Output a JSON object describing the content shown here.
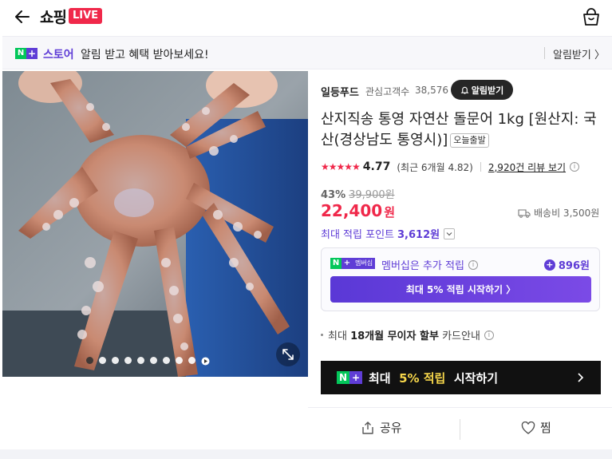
{
  "header": {
    "logo_text": "쇼핑",
    "live_badge": "LIVE",
    "back_icon": "arrow-left-icon",
    "cart_icon": "shopping-bag-icon"
  },
  "store_bar": {
    "n_badge": "N",
    "plus_badge": "+",
    "store_label": "스토어",
    "message": "알림 받고 혜택 받아보세요!",
    "alarm_link": "알림받기 〉"
  },
  "gallery": {
    "dot_count": 10,
    "active_index": 0,
    "expand_icon": "expand-arrows-icon",
    "play_icon": "play-icon"
  },
  "product": {
    "seller": "일등푸드",
    "fans_label": "관심고객수",
    "fans_count": "38,576",
    "alarm_button": "알림받기",
    "title": "산지직송 통영 자연산 돌문어 1kg [원산지: 국산(경상남도 통영시)]",
    "today_badge": "오늘출발",
    "stars": "★★★★★",
    "rating": "4.77",
    "recent_rating": "(최근 6개월 4.82)",
    "review_link": "2,920건 리뷰 보기",
    "discount_rate": "43%",
    "original_price": "39,900원",
    "price": "22,400",
    "price_unit": "원",
    "shipping": "배송비 3,500원",
    "max_points_label": "최대 적립 포인트",
    "max_points": "3,612원"
  },
  "membership": {
    "badge_n": "N",
    "badge_plus": "+",
    "badge_text": "멤버십",
    "text": "멤버십은 추가 적립",
    "points": "896원",
    "button": "최대 5% 적립 시작하기 〉"
  },
  "installment": {
    "prefix": "최대 ",
    "bold": "18개월 무이자 할부",
    "suffix": " 카드안내"
  },
  "banner": {
    "badge_n": "N",
    "badge_plus": "+",
    "prefix": "최대 ",
    "highlight": "5% 적립",
    "suffix": " 시작하기"
  },
  "actions": {
    "share": "공유",
    "wish": "찜"
  },
  "colors": {
    "brand_red": "#f0284a",
    "naver_green": "#03c75a",
    "plus_purple": "#5f3dd6"
  }
}
